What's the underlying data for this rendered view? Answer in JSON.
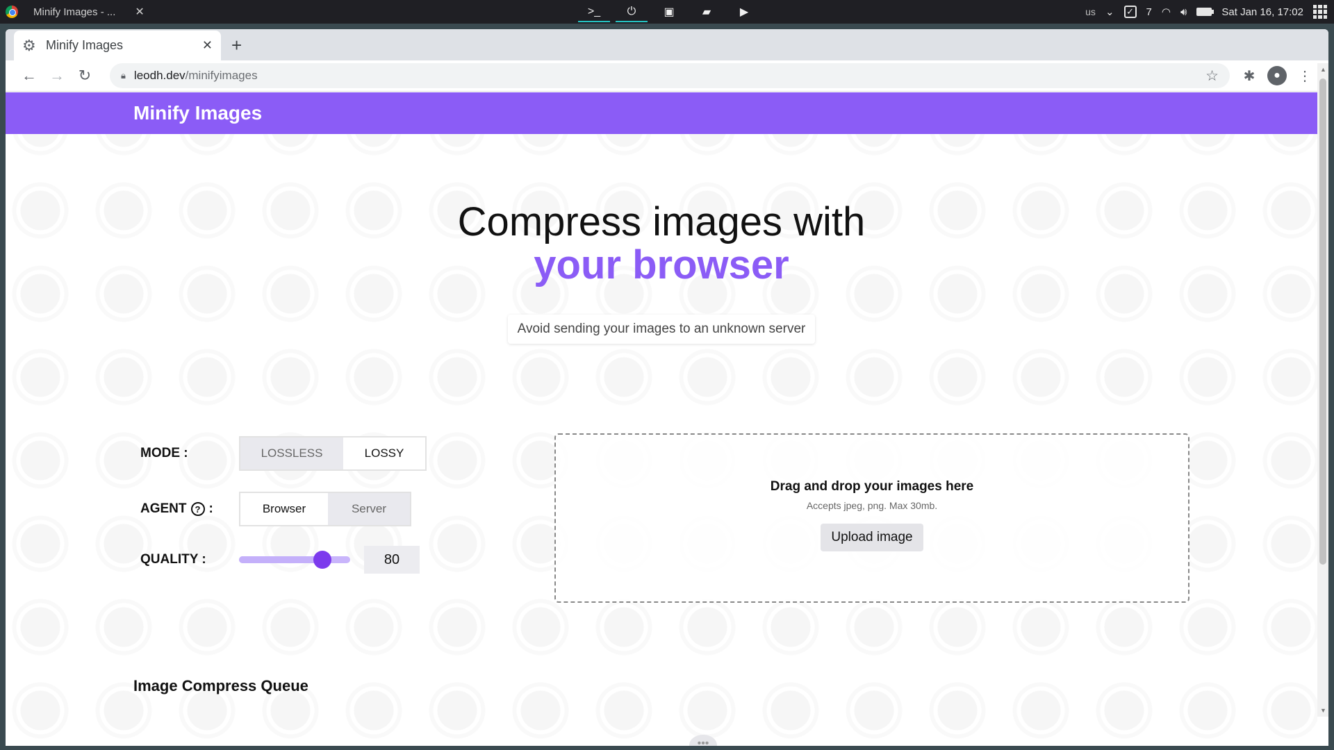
{
  "os": {
    "task_title": "Minify Images - ...",
    "task_close": "✕",
    "apps": [
      {
        "name": "terminal-icon",
        "glyph": ">_"
      },
      {
        "name": "power-icon",
        "glyph": "⏻"
      },
      {
        "name": "monitor-icon",
        "glyph": "▣"
      },
      {
        "name": "folder-icon",
        "glyph": "▰"
      },
      {
        "name": "youtube-icon",
        "glyph": "▶"
      }
    ],
    "keyboard_layout": "us",
    "task_count": "7",
    "datetime": "Sat Jan 16, 17:02"
  },
  "browser": {
    "tab_title": "Minify Images",
    "tab_close": "✕",
    "new_tab": "+",
    "url_host": "leodh.dev",
    "url_path": "/minifyimages"
  },
  "app": {
    "title": "Minify Images",
    "hero_line1": "Compress images with",
    "hero_line2": "your browser",
    "tagline": "Avoid sending your images to an unknown server",
    "mode": {
      "label": "MODE :",
      "options": [
        "LOSSLESS",
        "LOSSY"
      ],
      "selected": "LOSSY"
    },
    "agent": {
      "label": "AGENT",
      "suffix": ":",
      "help_glyph": "?",
      "options": [
        "Browser",
        "Server"
      ],
      "selected": "Browser"
    },
    "quality": {
      "label": "QUALITY :",
      "value": "80",
      "fraction": 0.75
    },
    "dropzone": {
      "title": "Drag and drop your images here",
      "subtitle": "Accepts jpeg, png. Max 30mb.",
      "button": "Upload image"
    },
    "queue_title": "Image Compress Queue"
  },
  "colors": {
    "accent": "#8b5cf6",
    "slider_thumb": "#7c3aed"
  }
}
